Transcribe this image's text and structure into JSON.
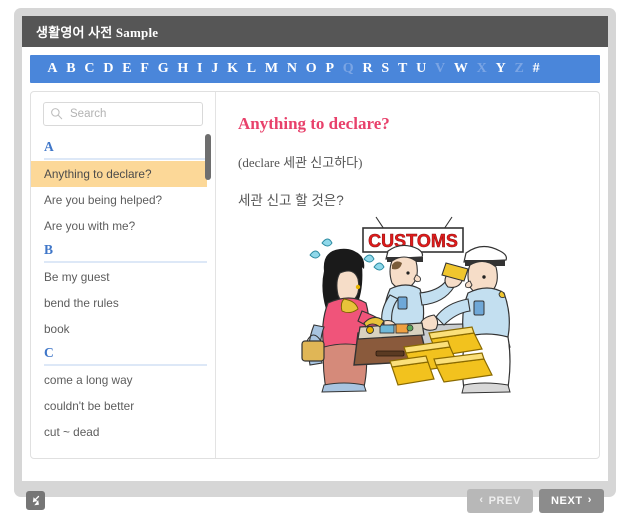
{
  "window": {
    "title": "생활영어 사전 Sample"
  },
  "alphabet_bar": {
    "letters": [
      {
        "label": "A",
        "enabled": true
      },
      {
        "label": "B",
        "enabled": true
      },
      {
        "label": "C",
        "enabled": true
      },
      {
        "label": "D",
        "enabled": true
      },
      {
        "label": "E",
        "enabled": true
      },
      {
        "label": "F",
        "enabled": true
      },
      {
        "label": "G",
        "enabled": true
      },
      {
        "label": "H",
        "enabled": true
      },
      {
        "label": "I",
        "enabled": true
      },
      {
        "label": "J",
        "enabled": true
      },
      {
        "label": "K",
        "enabled": true
      },
      {
        "label": "L",
        "enabled": true
      },
      {
        "label": "M",
        "enabled": true
      },
      {
        "label": "N",
        "enabled": true
      },
      {
        "label": "O",
        "enabled": true
      },
      {
        "label": "P",
        "enabled": true
      },
      {
        "label": "Q",
        "enabled": false
      },
      {
        "label": "R",
        "enabled": true
      },
      {
        "label": "S",
        "enabled": true
      },
      {
        "label": "T",
        "enabled": true
      },
      {
        "label": "U",
        "enabled": true
      },
      {
        "label": "V",
        "enabled": false
      },
      {
        "label": "W",
        "enabled": true
      },
      {
        "label": "X",
        "enabled": false
      },
      {
        "label": "Y",
        "enabled": true
      },
      {
        "label": "Z",
        "enabled": false
      },
      {
        "label": "#",
        "enabled": true
      }
    ]
  },
  "sidebar": {
    "search": {
      "value": "",
      "placeholder": "Search",
      "icon": "search-icon"
    },
    "sections": [
      {
        "letter": "A",
        "entries": [
          {
            "label": "Anything to declare?",
            "active": true
          },
          {
            "label": "Are you being helped?",
            "active": false
          },
          {
            "label": "Are you with me?",
            "active": false
          }
        ]
      },
      {
        "letter": "B",
        "entries": [
          {
            "label": "Be my guest",
            "active": false
          },
          {
            "label": "bend the rules",
            "active": false
          },
          {
            "label": "book",
            "active": false
          }
        ]
      },
      {
        "letter": "C",
        "entries": [
          {
            "label": "come a long way",
            "active": false
          },
          {
            "label": "couldn't be better",
            "active": false
          },
          {
            "label": "cut ~ dead",
            "active": false
          }
        ]
      }
    ]
  },
  "main": {
    "title": "Anything to declare?",
    "gloss": "(declare 세관 신고하다)",
    "translation": "세관 신고 할 것은?",
    "illustration": {
      "name": "customs-inspection-cartoon",
      "sign_text": "CUSTOMS"
    }
  },
  "footer": {
    "resize_handle": "resize-icon",
    "prev_label": "PREV",
    "next_label": "NEXT",
    "prev_chevron": "‹",
    "next_chevron": "›"
  },
  "colors": {
    "title_bar": "#565656",
    "alpha_bar": "#4a86da",
    "alpha_disabled": "#7ba5e4",
    "shell": "#d6d6d6",
    "entry_active": "#fcd898",
    "section_letter": "#3f76c8",
    "entry_title": "#e8416b",
    "next_button": "#8c8c8c",
    "prev_button": "#b8b8b8"
  }
}
